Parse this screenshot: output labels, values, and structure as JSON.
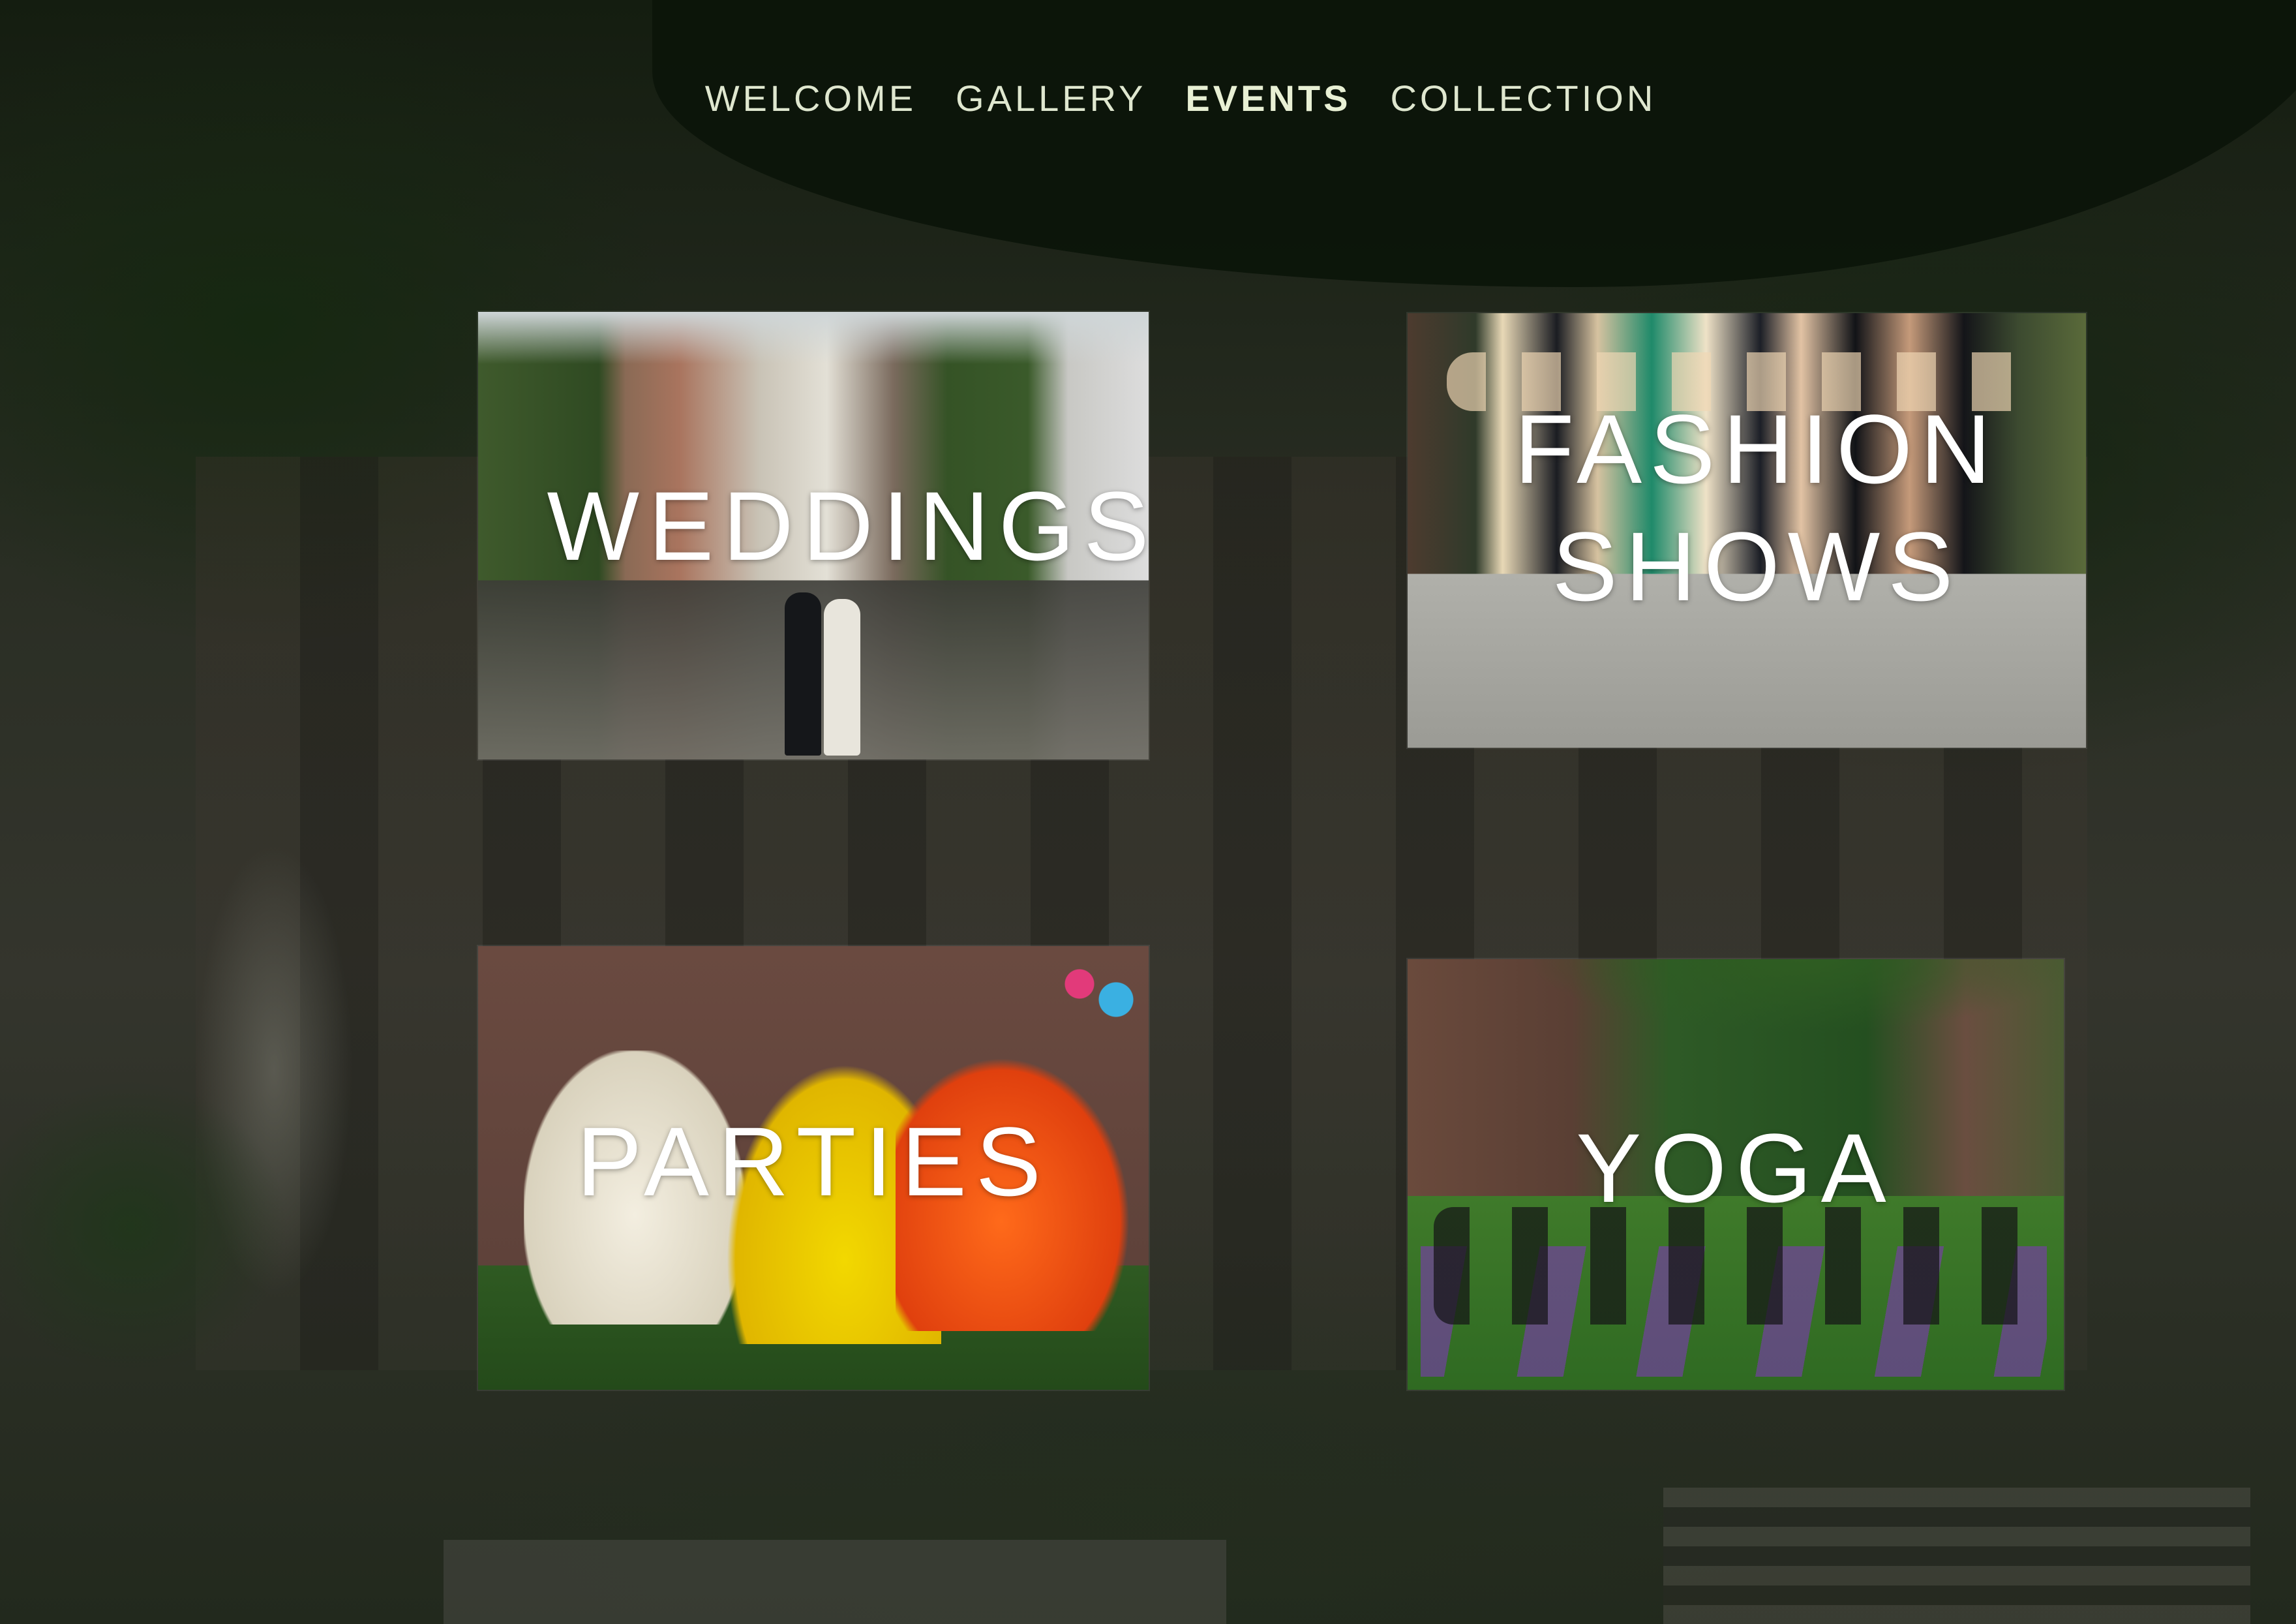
{
  "nav": {
    "items": [
      {
        "label": "WELCOME",
        "active": false
      },
      {
        "label": "GALLERY",
        "active": false
      },
      {
        "label": "EVENTS",
        "active": true
      },
      {
        "label": "COLLECTION",
        "active": false
      }
    ]
  },
  "events": {
    "weddings": {
      "label": "WEDDINGS"
    },
    "fashion_shows": {
      "line1": "FASHION",
      "line2": "SHOWS"
    },
    "parties": {
      "label": "PARTIES"
    },
    "yoga": {
      "label": "YOGA"
    }
  }
}
